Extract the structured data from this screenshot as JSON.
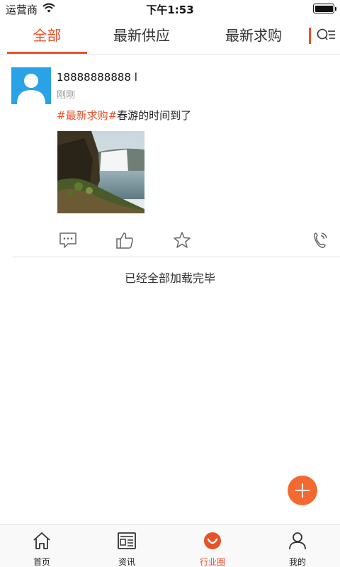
{
  "status_bar": {
    "carrier": "运营商",
    "time": "下午1:53"
  },
  "tabs": [
    {
      "label": "全部",
      "active": true
    },
    {
      "label": "最新供应",
      "active": false
    },
    {
      "label": "最新求购",
      "active": false
    }
  ],
  "post": {
    "username": "18888888888 l",
    "time": "刚刚",
    "hashtag": "#最新求购#",
    "text": "春游的时间到了",
    "image": "waterfall-photo"
  },
  "actions": [
    "comment-icon",
    "like-icon",
    "favorite-icon",
    "phone-icon"
  ],
  "load_complete_text": "已经全部加载完毕",
  "bottom_nav": [
    {
      "label": "首页",
      "icon": "home-icon",
      "active": false
    },
    {
      "label": "资讯",
      "icon": "news-icon",
      "active": false
    },
    {
      "label": "行业圈",
      "icon": "circle-icon",
      "active": true
    },
    {
      "label": "我的",
      "icon": "user-icon",
      "active": false
    }
  ],
  "colors": {
    "accent": "#e8522a",
    "fab": "#f26a2f",
    "avatar_bg": "#2aa3e6"
  }
}
